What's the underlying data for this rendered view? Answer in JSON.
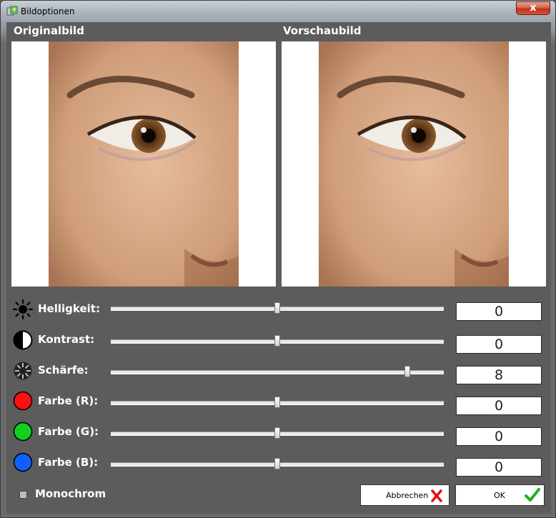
{
  "window": {
    "title": "Bildoptionen",
    "close_glyph": "x"
  },
  "panels": {
    "original_label": "Originalbild",
    "preview_label": "Vorschaubild"
  },
  "adjustments": [
    {
      "label": "Helligkeit:",
      "value": "0",
      "level": 0.5,
      "icon": "brightness-icon"
    },
    {
      "label": "Kontrast:",
      "value": "0",
      "level": 0.5,
      "icon": "contrast-icon"
    },
    {
      "label": "Schärfe:",
      "value": "8",
      "level": 0.89,
      "icon": "sharpness-icon"
    },
    {
      "label": "Farbe (R):",
      "value": "0",
      "level": 0.5,
      "icon": "red-dot-icon",
      "color": "#ff1010"
    },
    {
      "label": "Farbe (G):",
      "value": "0",
      "level": 0.5,
      "icon": "green-dot-icon",
      "color": "#10d020"
    },
    {
      "label": "Farbe (B):",
      "value": "0",
      "level": 0.5,
      "icon": "blue-dot-icon",
      "color": "#1060ff"
    }
  ],
  "monochrom": {
    "label": "Monochrom",
    "checked": false
  },
  "buttons": {
    "cancel_label": "Abbrechen",
    "ok_label": "OK"
  },
  "colors": {
    "background": "#5c5c5c",
    "cancel_icon": "#e01010",
    "ok_icon": "#20b020"
  }
}
